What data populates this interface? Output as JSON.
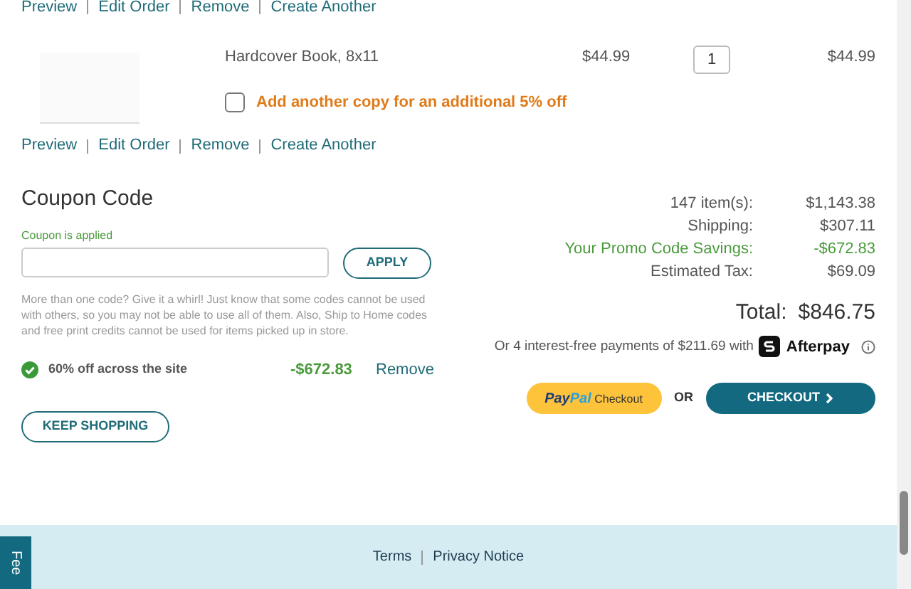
{
  "top_item_links": [
    "Preview",
    "Edit Order",
    "Remove",
    "Create Another"
  ],
  "line_item": {
    "name": "Hardcover Book, 8x11",
    "price": "$44.99",
    "quantity": "1",
    "total": "$44.99",
    "upsell": {
      "label": "Add another copy for an additional 5% off",
      "checked": false
    }
  },
  "item_links": [
    "Preview",
    "Edit Order",
    "Remove",
    "Create Another"
  ],
  "coupon": {
    "title": "Coupon Code",
    "status": "Coupon is applied",
    "apply_button": "APPLY",
    "note": "More than one code? Give it a whirl! Just know that some codes cannot be used with others, so you may not be able to use all of them. Also, Ship to Home codes and free print credits cannot be used for items picked up in store.",
    "applied": {
      "label": "60% off across the site",
      "amount": "-$672.83",
      "remove": "Remove"
    }
  },
  "summary": {
    "rows": [
      {
        "label": "147 item(s):",
        "value": "$1,143.38",
        "kind": "normal"
      },
      {
        "label": "Shipping:",
        "value": "$307.11",
        "kind": "normal"
      },
      {
        "label": "Your Promo Code Savings:",
        "value": "-$672.83",
        "kind": "savings"
      },
      {
        "label": "Estimated Tax:",
        "value": "$69.09",
        "kind": "normal"
      }
    ],
    "total_label": "Total:",
    "total_value": "$846.75",
    "installments": "Or 4 interest-free payments of $211.69 with",
    "afterpay": "Afterpay"
  },
  "actions": {
    "keep_shopping": "KEEP SHOPPING",
    "paypal_logo": [
      "Pay",
      "Pal"
    ],
    "paypal_label": "Checkout",
    "or": "OR",
    "checkout": "CHECKOUT"
  },
  "footer_links": [
    "Terms",
    "Privacy Notice"
  ],
  "feedback_tab": "Fee"
}
